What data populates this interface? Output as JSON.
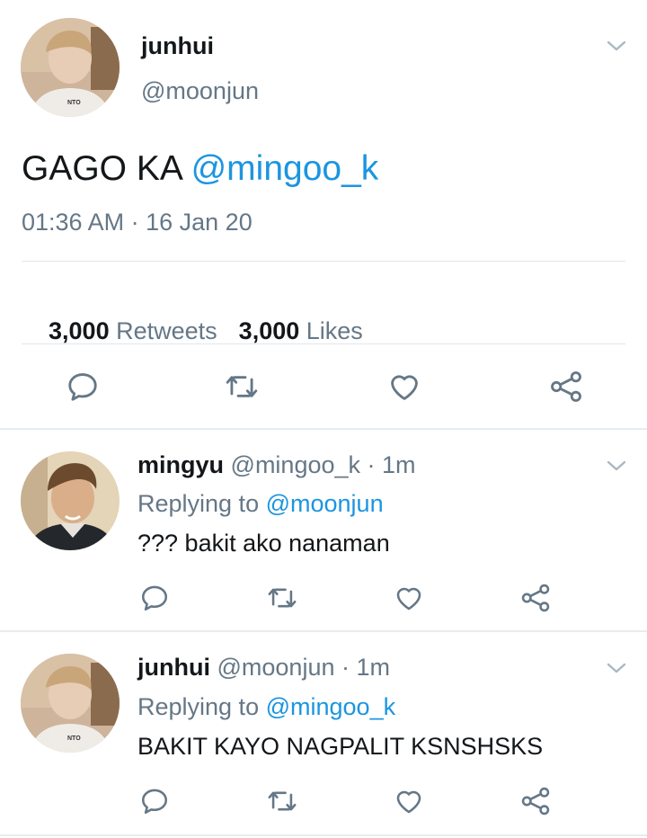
{
  "main_tweet": {
    "display_name": "junhui",
    "handle": "@moonjun",
    "text_prefix": "GAGO KA ",
    "mention": "@mingoo_k",
    "time": "01:36 AM",
    "separator": "·",
    "date": "16 Jan 20",
    "retweet_count": "3,000",
    "retweet_label": "Retweets",
    "like_count": "3,000",
    "like_label": "Likes"
  },
  "replies": [
    {
      "display_name": "mingyu",
      "handle": "@mingoo_k",
      "time": "· 1m",
      "replying_label": "Replying to",
      "replying_to": "@moonjun",
      "text": "??? bakit ako nanaman"
    },
    {
      "display_name": "junhui",
      "handle": "@moonjun",
      "time": "· 1m",
      "replying_label": "Replying to",
      "replying_to": "@mingoo_k",
      "text": "BAKIT KAYO NAGPALIT KSNSHSKS"
    }
  ],
  "icons": {
    "reply": "reply-icon",
    "retweet": "retweet-icon",
    "like": "heart-icon",
    "share": "share-icon",
    "more": "chevron-down-icon"
  },
  "colors": {
    "link": "#1b95e0",
    "muted": "#657786",
    "text": "#14171a",
    "divider": "#e1e8ed"
  }
}
